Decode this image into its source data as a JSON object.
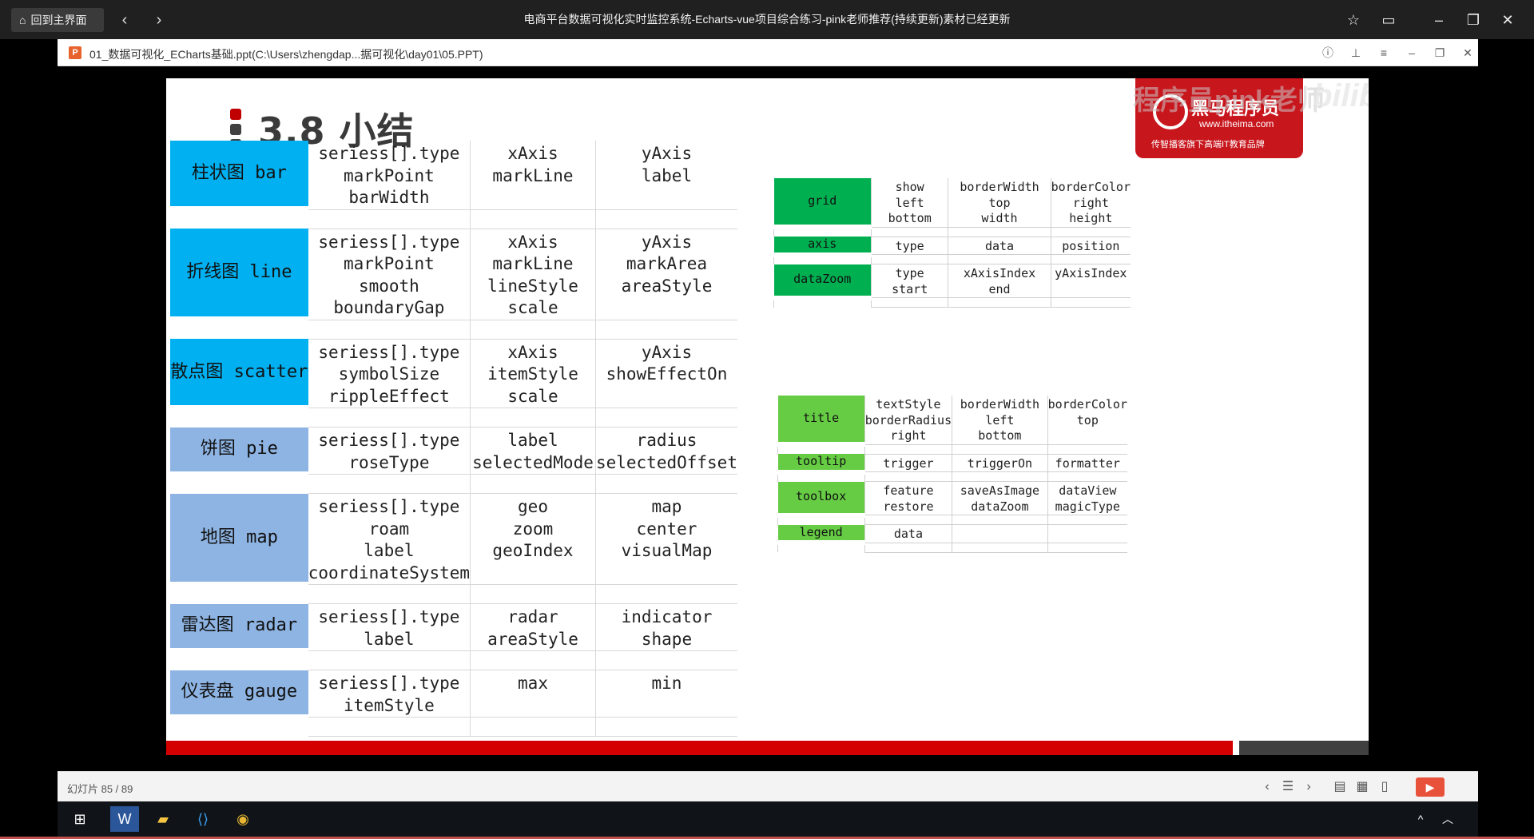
{
  "titlebar": {
    "home_label": "回到主界面",
    "title": "电商平台数据可视化实时监控系统-Echarts-vue项目综合练习-pink老师推荐(持续更新)素材已经更新"
  },
  "pptbar": {
    "app_letter": "P",
    "file_label": "01_数据可视化_ECharts基础.ppt(C:\\Users\\zhengdap...据可视化\\day01\\05.PPT)"
  },
  "slide": {
    "title": "3.8 小结",
    "watermark": "程序员pink老师",
    "logo_title": "黑马程序员",
    "logo_url": "www.itheima.com",
    "logo_sub": "传智播客旗下高端IT教育品牌",
    "bilibili": "bilibili",
    "title_mark_colors": [
      "#c00000",
      "#404040",
      "#404040"
    ],
    "big_table": [
      {
        "label": "柱状图 bar",
        "color": "#00b0f0",
        "lines": [
          [
            "seriess[].type",
            "xAxis",
            "yAxis"
          ],
          [
            "markPoint",
            "markLine",
            "label"
          ],
          [
            "barWidth",
            "",
            ""
          ]
        ]
      },
      {
        "label": "折线图 line",
        "color": "#00b0f0",
        "lines": [
          [
            "seriess[].type",
            "xAxis",
            "yAxis"
          ],
          [
            "markPoint",
            "markLine",
            "markArea"
          ],
          [
            "smooth",
            "lineStyle",
            "areaStyle"
          ],
          [
            "boundaryGap",
            "scale",
            ""
          ]
        ]
      },
      {
        "label": "散点图 scatter",
        "color": "#00b0f0",
        "lines": [
          [
            "seriess[].type",
            "xAxis",
            "yAxis"
          ],
          [
            "symbolSize",
            "itemStyle",
            "showEffectOn"
          ],
          [
            "rippleEffect",
            "scale",
            ""
          ]
        ]
      },
      {
        "label": "饼图 pie",
        "color": "#8eb4e3",
        "lines": [
          [
            "seriess[].type",
            "label",
            "radius"
          ],
          [
            "roseType",
            "selectedMode",
            "selectedOffset"
          ]
        ]
      },
      {
        "label": "地图 map",
        "color": "#8eb4e3",
        "lines": [
          [
            "seriess[].type",
            "geo",
            "map"
          ],
          [
            "roam",
            "zoom",
            "center"
          ],
          [
            "label",
            "geoIndex",
            "visualMap"
          ],
          [
            "coordinateSystem",
            "",
            ""
          ]
        ]
      },
      {
        "label": "雷达图 radar",
        "color": "#8eb4e3",
        "lines": [
          [
            "seriess[].type",
            "radar",
            "indicator"
          ],
          [
            "label",
            "areaStyle",
            "shape"
          ]
        ]
      },
      {
        "label": "仪表盘 gauge",
        "color": "#8eb4e3",
        "lines": [
          [
            "seriess[].type",
            "max",
            "min"
          ],
          [
            "itemStyle",
            "",
            ""
          ]
        ]
      }
    ],
    "right_table_1": [
      {
        "label": "grid",
        "lines": [
          [
            "show",
            "borderWidth",
            "borderColor"
          ],
          [
            "left",
            "top",
            "right"
          ],
          [
            "bottom",
            "width",
            "height"
          ]
        ]
      },
      {
        "label": "axis",
        "lines": [
          [
            "type",
            "data",
            "position"
          ]
        ]
      },
      {
        "label": "dataZoom",
        "lines": [
          [
            "type",
            "xAxisIndex",
            "yAxisIndex"
          ],
          [
            "start",
            "end",
            ""
          ]
        ]
      }
    ],
    "right_table_2": [
      {
        "label": "title",
        "lines": [
          [
            "textStyle",
            "borderWidth",
            "borderColor"
          ],
          [
            "borderRadius",
            "left",
            "top"
          ],
          [
            "right",
            "bottom",
            ""
          ]
        ]
      },
      {
        "label": "tooltip",
        "lines": [
          [
            "trigger",
            "triggerOn",
            "formatter"
          ]
        ]
      },
      {
        "label": "toolbox",
        "lines": [
          [
            "feature",
            "saveAsImage",
            "dataView"
          ],
          [
            "restore",
            "dataZoom",
            "magicType"
          ]
        ]
      },
      {
        "label": "legend",
        "lines": [
          [
            "data",
            "",
            ""
          ]
        ]
      }
    ]
  },
  "statusbar": {
    "slide_count": "幻灯片 85 / 89"
  }
}
